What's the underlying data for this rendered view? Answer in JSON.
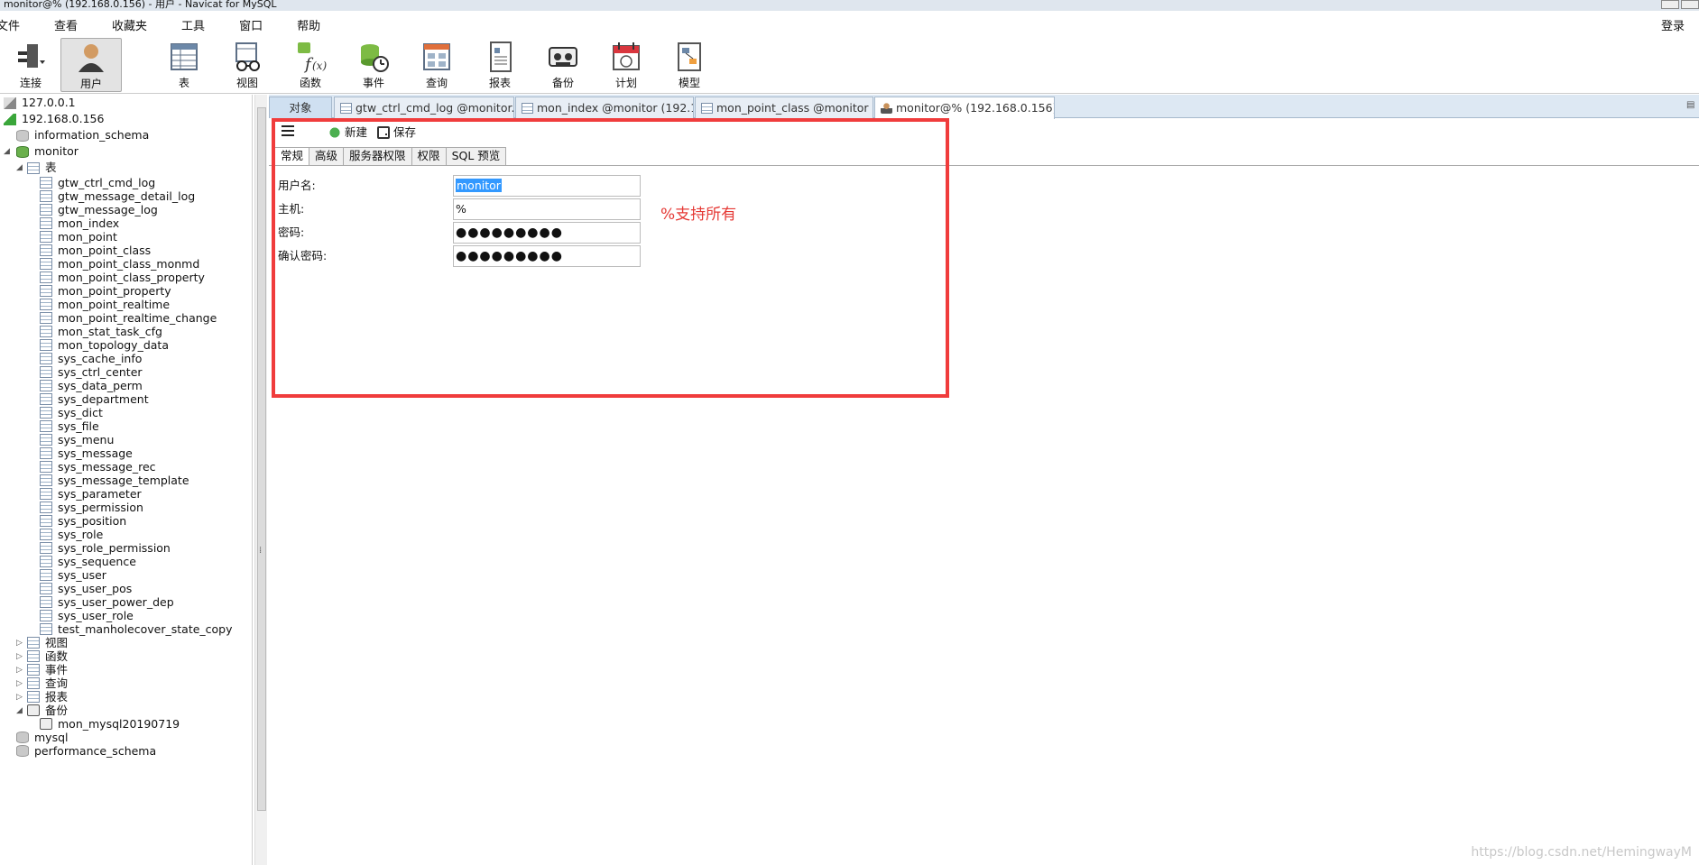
{
  "window": {
    "title": "monitor@% (192.168.0.156) - 用户 - Navicat for MySQL"
  },
  "menu": {
    "items": [
      "文件",
      "查看",
      "收藏夹",
      "工具",
      "窗口",
      "帮助"
    ],
    "login": "登录"
  },
  "toolbar": {
    "buttons": [
      {
        "label": "连接",
        "icon": "plug-icon"
      },
      {
        "label": "用户",
        "icon": "user-icon"
      },
      {
        "label": "表",
        "icon": "table-icon"
      },
      {
        "label": "视图",
        "icon": "view-icon"
      },
      {
        "label": "函数",
        "icon": "function-icon"
      },
      {
        "label": "事件",
        "icon": "event-icon"
      },
      {
        "label": "查询",
        "icon": "query-icon"
      },
      {
        "label": "报表",
        "icon": "report-icon"
      },
      {
        "label": "备份",
        "icon": "backup-icon"
      },
      {
        "label": "计划",
        "icon": "schedule-icon"
      },
      {
        "label": "模型",
        "icon": "model-icon"
      }
    ]
  },
  "sidebar": {
    "connections": [
      "127.0.0.1",
      "192.168.0.156"
    ],
    "databases": {
      "information_schema": "information_schema",
      "monitor": "monitor",
      "mysql": "mysql",
      "performance_schema": "performance_schema"
    },
    "tables_group": "表",
    "tables": [
      "gtw_ctrl_cmd_log",
      "gtw_message_detail_log",
      "gtw_message_log",
      "mon_index",
      "mon_point",
      "mon_point_class",
      "mon_point_class_monmd",
      "mon_point_class_property",
      "mon_point_property",
      "mon_point_realtime",
      "mon_point_realtime_change",
      "mon_stat_task_cfg",
      "mon_topology_data",
      "sys_cache_info",
      "sys_ctrl_center",
      "sys_data_perm",
      "sys_department",
      "sys_dict",
      "sys_file",
      "sys_menu",
      "sys_message",
      "sys_message_rec",
      "sys_message_template",
      "sys_parameter",
      "sys_permission",
      "sys_position",
      "sys_role",
      "sys_role_permission",
      "sys_sequence",
      "sys_user",
      "sys_user_pos",
      "sys_user_power_dep",
      "sys_user_role",
      "test_manholecover_state_copy"
    ],
    "groups": [
      "视图",
      "函数",
      "事件",
      "查询",
      "报表",
      "备份"
    ],
    "backups": [
      "mon_mysql20190719"
    ]
  },
  "tabs": [
    {
      "label": "对象"
    },
    {
      "label": "gtw_ctrl_cmd_log @monitor..."
    },
    {
      "label": "mon_index @monitor (192.1..."
    },
    {
      "label": "mon_point_class @monitor ..."
    },
    {
      "label": "monitor@% (192.168.0.156)..."
    }
  ],
  "editor": {
    "new_label": "新建",
    "save_label": "保存",
    "subtabs": [
      "常规",
      "高级",
      "服务器权限",
      "权限",
      "SQL 预览"
    ],
    "fields": {
      "username_label": "用户名:",
      "username_value": "monitor",
      "host_label": "主机:",
      "host_value": "%",
      "password_label": "密码:",
      "password_value": "●●●●●●●●●",
      "confirm_label": "确认密码:",
      "confirm_value": "●●●●●●●●●"
    },
    "annotation": "%支持所有"
  },
  "watermark": "https://blog.csdn.net/HemingwayM",
  "colors": {
    "highlight_box": "#f03c3c",
    "annotation_text": "#e53935",
    "selection": "#3399ff"
  }
}
